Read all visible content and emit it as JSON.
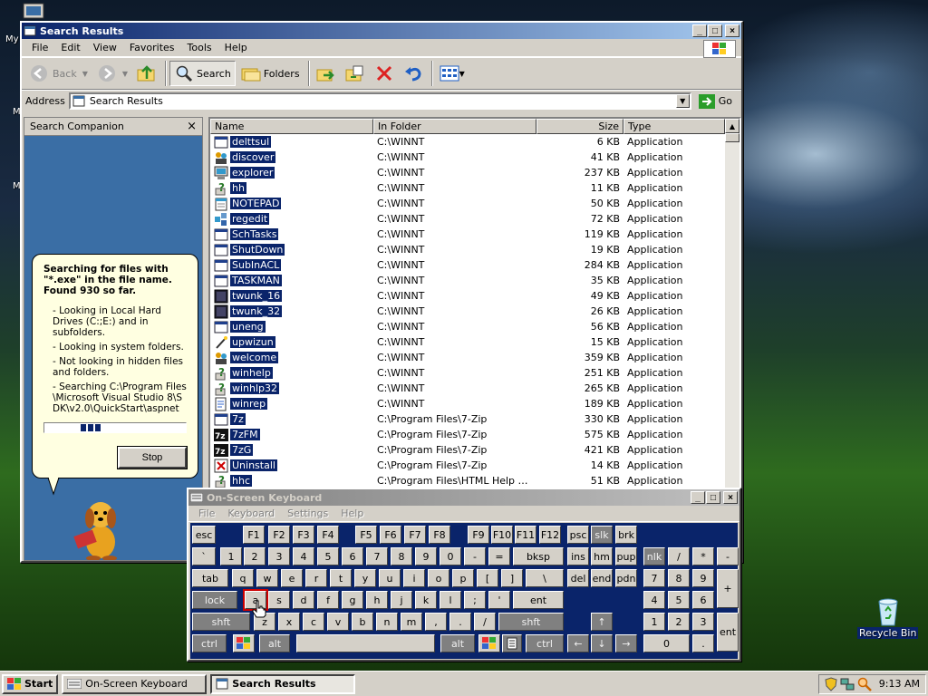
{
  "desktop": {
    "top_label": "My",
    "recycle_label": "Recycle Bin",
    "side_marks": [
      "M",
      "M"
    ]
  },
  "explorer": {
    "title": "Search Results",
    "menu": [
      "File",
      "Edit",
      "View",
      "Favorites",
      "Tools",
      "Help"
    ],
    "toolbar": {
      "back": "Back",
      "search": "Search",
      "folders": "Folders"
    },
    "address_label": "Address",
    "address_value": "Search Results",
    "go_label": "Go",
    "companion": {
      "title": "Search Companion",
      "status": "Searching for files with \"*.exe\" in the file name. Found 930 so far.",
      "details": [
        "- Looking in Local Hard Drives (C:;E:) and in subfolders.",
        "- Looking in system folders.",
        "- Not looking in hidden files and folders.",
        "- Searching C:\\Program Files\\Microsoft Visual Studio 8\\SDK\\v2.0\\QuickStart\\aspnet"
      ],
      "stop_label": "Stop"
    },
    "columns": {
      "name": "Name",
      "folder": "In Folder",
      "size": "Size",
      "type": "Type"
    },
    "rows": [
      {
        "name": "delttsul",
        "folder": "C:\\WINNT",
        "size": "6 KB",
        "type": "Application",
        "icon": "window"
      },
      {
        "name": "discover",
        "folder": "C:\\WINNT",
        "size": "41 KB",
        "type": "Application",
        "icon": "people"
      },
      {
        "name": "explorer",
        "folder": "C:\\WINNT",
        "size": "237 KB",
        "type": "Application",
        "icon": "computer"
      },
      {
        "name": "hh",
        "folder": "C:\\WINNT",
        "size": "11 KB",
        "type": "Application",
        "icon": "help"
      },
      {
        "name": "NOTEPAD",
        "folder": "C:\\WINNT",
        "size": "50 KB",
        "type": "Application",
        "icon": "notepad"
      },
      {
        "name": "regedit",
        "folder": "C:\\WINNT",
        "size": "72 KB",
        "type": "Application",
        "icon": "regedit"
      },
      {
        "name": "SchTasks",
        "folder": "C:\\WINNT",
        "size": "119 KB",
        "type": "Application",
        "icon": "window"
      },
      {
        "name": "ShutDown",
        "folder": "C:\\WINNT",
        "size": "19 KB",
        "type": "Application",
        "icon": "window"
      },
      {
        "name": "SubInACL",
        "folder": "C:\\WINNT",
        "size": "284 KB",
        "type": "Application",
        "icon": "window"
      },
      {
        "name": "TASKMAN",
        "folder": "C:\\WINNT",
        "size": "35 KB",
        "type": "Application",
        "icon": "window"
      },
      {
        "name": "twunk_16",
        "folder": "C:\\WINNT",
        "size": "49 KB",
        "type": "Application",
        "icon": "dark"
      },
      {
        "name": "twunk_32",
        "folder": "C:\\WINNT",
        "size": "26 KB",
        "type": "Application",
        "icon": "dark"
      },
      {
        "name": "uneng",
        "folder": "C:\\WINNT",
        "size": "56 KB",
        "type": "Application",
        "icon": "window"
      },
      {
        "name": "upwizun",
        "folder": "C:\\WINNT",
        "size": "15 KB",
        "type": "Application",
        "icon": "wand"
      },
      {
        "name": "welcome",
        "folder": "C:\\WINNT",
        "size": "359 KB",
        "type": "Application",
        "icon": "people"
      },
      {
        "name": "winhelp",
        "folder": "C:\\WINNT",
        "size": "251 KB",
        "type": "Application",
        "icon": "help"
      },
      {
        "name": "winhlp32",
        "folder": "C:\\WINNT",
        "size": "265 KB",
        "type": "Application",
        "icon": "help"
      },
      {
        "name": "winrep",
        "folder": "C:\\WINNT",
        "size": "189 KB",
        "type": "Application",
        "icon": "report"
      },
      {
        "name": "7z",
        "folder": "C:\\Program Files\\7-Zip",
        "size": "330 KB",
        "type": "Application",
        "icon": "window"
      },
      {
        "name": "7zFM",
        "folder": "C:\\Program Files\\7-Zip",
        "size": "575 KB",
        "type": "Application",
        "icon": "7z"
      },
      {
        "name": "7zG",
        "folder": "C:\\Program Files\\7-Zip",
        "size": "421 KB",
        "type": "Application",
        "icon": "7z"
      },
      {
        "name": "Uninstall",
        "folder": "C:\\Program Files\\7-Zip",
        "size": "14 KB",
        "type": "Application",
        "icon": "uninstall"
      },
      {
        "name": "hhc",
        "folder": "C:\\Program Files\\HTML Help Wor...",
        "size": "51 KB",
        "type": "Application",
        "icon": "help"
      }
    ]
  },
  "osk": {
    "title": "On-Screen Keyboard",
    "menu": [
      "File",
      "Keyboard",
      "Settings",
      "Help"
    ],
    "keys": {
      "esc": "esc",
      "f1": "F1",
      "f2": "F2",
      "f3": "F3",
      "f4": "F4",
      "f5": "F5",
      "f6": "F6",
      "f7": "F7",
      "f8": "F8",
      "f9": "F9",
      "f10": "F10",
      "f11": "F11",
      "f12": "F12",
      "psc": "psc",
      "slk": "slk",
      "brk": "brk",
      "tick": "`",
      "k1": "1",
      "k2": "2",
      "k3": "3",
      "k4": "4",
      "k5": "5",
      "k6": "6",
      "k7": "7",
      "k8": "8",
      "k9": "9",
      "k0": "0",
      "minus": "-",
      "equals": "=",
      "bksp": "bksp",
      "ins": "ins",
      "hm": "hm",
      "pup": "pup",
      "nlk": "nlk",
      "npslash": "/",
      "npstar": "*",
      "npminus": "-",
      "tab": "tab",
      "q": "q",
      "w": "w",
      "e": "e",
      "r": "r",
      "t": "t",
      "y": "y",
      "u": "u",
      "i": "i",
      "o": "o",
      "p": "p",
      "lbr": "[",
      "rbr": "]",
      "bslash": "\\",
      "del": "del",
      "end": "end",
      "pdn": "pdn",
      "np7": "7",
      "np8": "8",
      "np9": "9",
      "npplus": "+",
      "lock": "lock",
      "a": "a",
      "s": "s",
      "d": "d",
      "f": "f",
      "g": "g",
      "h": "h",
      "j": "j",
      "k": "k",
      "l": "l",
      "semi": ";",
      "quote": "'",
      "ent": "ent",
      "np4": "4",
      "np5": "5",
      "np6": "6",
      "lshift": "shft",
      "z": "z",
      "x": "x",
      "c": "c",
      "v": "v",
      "b": "b",
      "n": "n",
      "m": "m",
      "comma": ",",
      "period": ".",
      "slash": "/",
      "rshift": "shft",
      "up": "↑",
      "np1": "1",
      "np2": "2",
      "np3": "3",
      "npent": "ent",
      "lctrl": "ctrl",
      "lalt": "alt",
      "ralt": "alt",
      "rctrl": "ctrl",
      "left": "←",
      "down": "↓",
      "right": "→",
      "np0": "0",
      "npdot": "."
    }
  },
  "taskbar": {
    "start_label": "Start",
    "tasks": [
      "On-Screen Keyboard",
      "Search Results"
    ],
    "clock": "9:13 AM"
  },
  "colors": {
    "title_active": "#0a246a",
    "selection": "#0a246a",
    "face": "#d4d0c8"
  }
}
